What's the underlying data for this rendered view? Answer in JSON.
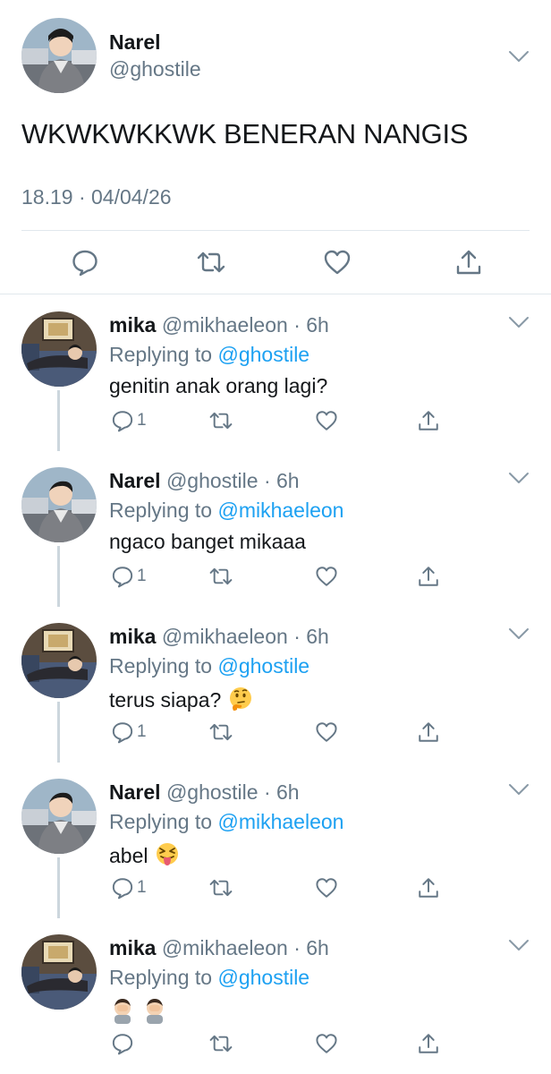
{
  "colors": {
    "accent": "#1da1f2",
    "secondary_text": "#657786",
    "divider": "#e1e8ed",
    "thread_line": "#ccd6dd"
  },
  "main_tweet": {
    "name": "Narel",
    "handle": "@ghostile",
    "text": "WKWKWKKWK BENERAN NANGIS",
    "timestamp": "18.19 · 04/04/26",
    "actions": [
      "reply-icon",
      "retweet-icon",
      "like-icon",
      "share-icon"
    ]
  },
  "replies": [
    {
      "name": "mika",
      "handle": "@mikhaeleon",
      "dot": "·",
      "time": "6h",
      "replying_prefix": "Replying to ",
      "replying_to": "@ghostile",
      "text": "genitin anak orang lagi?",
      "reply_count": "1",
      "emoji": ""
    },
    {
      "name": "Narel",
      "handle": "@ghostile",
      "dot": "·",
      "time": "6h",
      "replying_prefix": "Replying to ",
      "replying_to": "@mikhaeleon",
      "text": "ngaco banget mikaaa",
      "reply_count": "1",
      "emoji": ""
    },
    {
      "name": "mika",
      "handle": "@mikhaeleon",
      "dot": "·",
      "time": "6h",
      "replying_prefix": "Replying to ",
      "replying_to": "@ghostile",
      "text": "terus siapa?",
      "reply_count": "1",
      "emoji": "thinking-face-emoji"
    },
    {
      "name": "Narel",
      "handle": "@ghostile",
      "dot": "·",
      "time": "6h",
      "replying_prefix": "Replying to ",
      "replying_to": "@mikhaeleon",
      "text": "abel",
      "reply_count": "1",
      "emoji": "squinting-tongue-emoji"
    },
    {
      "name": "mika",
      "handle": "@mikhaeleon",
      "dot": "·",
      "time": "6h",
      "replying_prefix": "Replying to ",
      "replying_to": "@ghostile",
      "text": "",
      "reply_count": "",
      "emoji": "face-palm-emoji-pair"
    }
  ]
}
